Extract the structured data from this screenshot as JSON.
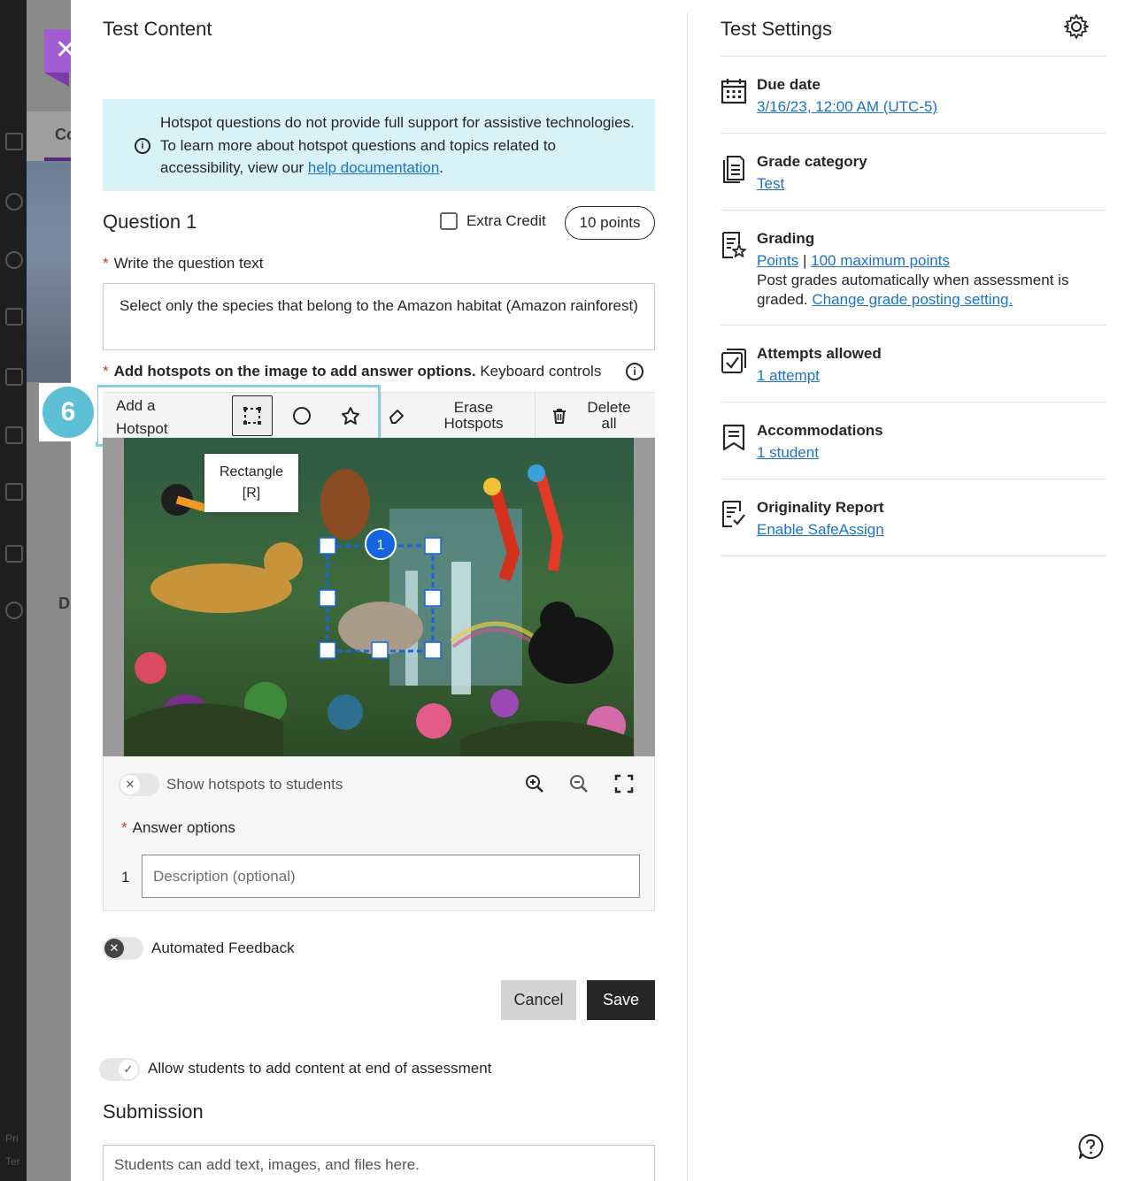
{
  "background": {
    "tab_label": "Co",
    "letter_d": "D",
    "footer_pri": "Pri",
    "footer_ter": "Ter"
  },
  "header": {
    "title": "Test Content"
  },
  "info_banner": {
    "text": "Hotspot questions do not provide full support for assistive technologies. To learn more about hotspot questions and topics related to accessibility, view our ",
    "link_text": "help documentation",
    "text_end": "."
  },
  "question": {
    "title": "Question 1",
    "extra_credit_label": "Extra Credit",
    "points_label": "10 points",
    "prompt_label": "Write the question text",
    "text": "Select only the species that belong to the Amazon habitat (Amazon rainforest)"
  },
  "hotspots": {
    "label_bold": "Add hotspots on the image to add answer options.",
    "label_rest": " Keyboard controls",
    "toolbar": {
      "add_label_line1": "Add a",
      "add_label_line2": "Hotspot",
      "erase_line1": "Erase",
      "erase_line2": "Hotspots",
      "delete_line1": "Delete",
      "delete_line2": "all"
    },
    "tooltip_line1": "Rectangle",
    "tooltip_line2": "[R]",
    "hotspot_number": "1",
    "step_badge": "6",
    "show_label": "Show hotspots to students"
  },
  "answers": {
    "label": "Answer options",
    "items": [
      {
        "num": "1",
        "placeholder": "Description (optional)"
      }
    ]
  },
  "feedback": {
    "label": "Automated Feedback"
  },
  "buttons": {
    "cancel": "Cancel",
    "save": "Save"
  },
  "allow": {
    "label": "Allow students to add content at end of assessment"
  },
  "submission": {
    "title": "Submission",
    "placeholder": "Students can add text, images, and files here."
  },
  "settings": {
    "title": "Test Settings",
    "due": {
      "name": "Due date",
      "value": "3/16/23, 12:00 AM (UTC-5)"
    },
    "category": {
      "name": "Grade category",
      "value": "Test"
    },
    "grading": {
      "name": "Grading",
      "link1": "Points",
      "sep": " | ",
      "link2": "100 maximum points",
      "line2": "Post grades automatically when assessment is",
      "line3_prefix": "graded. ",
      "line3_link": "Change grade posting setting."
    },
    "attempts": {
      "name": "Attempts allowed",
      "value": "1 attempt"
    },
    "accommodations": {
      "name": "Accommodations",
      "value": "1 student"
    },
    "originality": {
      "name": "Originality Report",
      "value": "Enable SafeAssign"
    }
  },
  "colors": {
    "accent": "#a25bd0",
    "link": "#1a73c8",
    "info_bg": "#d8f2f8",
    "highlight": "#8ecbdc",
    "hotspot": "#1565e0"
  }
}
